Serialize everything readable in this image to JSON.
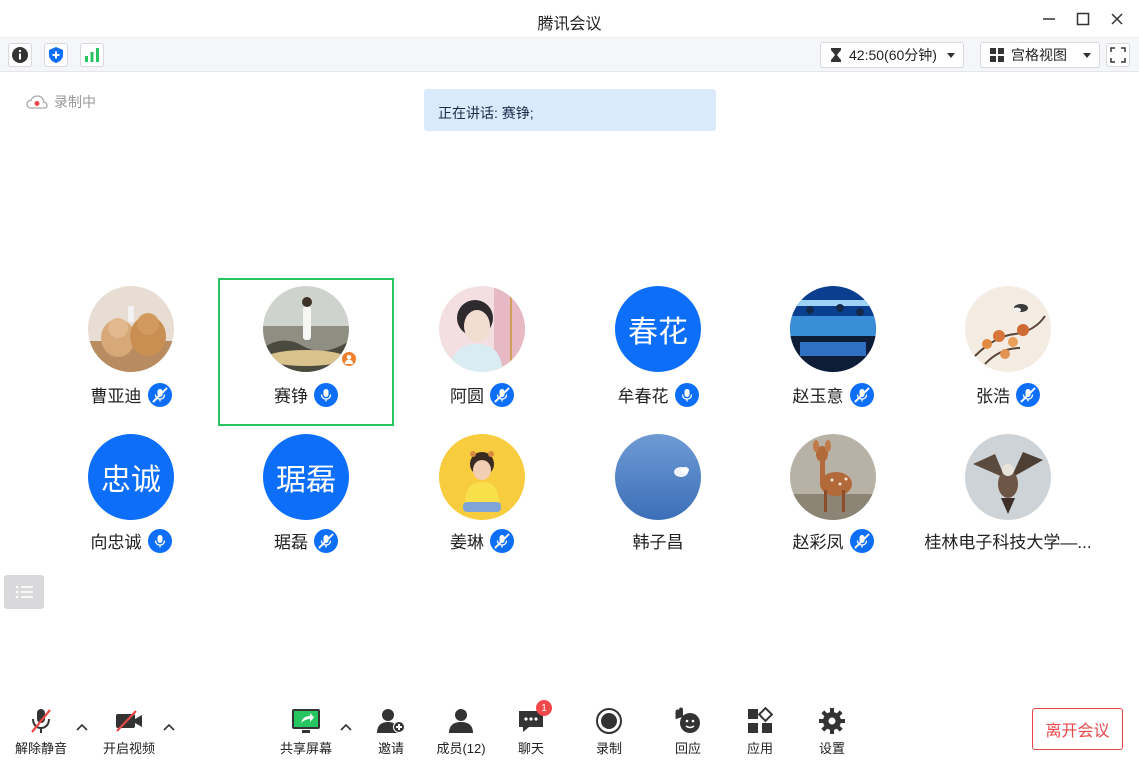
{
  "window": {
    "title": "腾讯会议"
  },
  "toolbar": {
    "timer": "42:50(60分钟)",
    "view_mode": "宫格视图"
  },
  "status": {
    "recording_label": "录制中",
    "speaking_label": "正在讲话: 赛铮;"
  },
  "participants": [
    {
      "name": "曹亚迪",
      "avatar_text": "",
      "mic": "muted"
    },
    {
      "name": "赛铮",
      "avatar_text": "",
      "mic": "on"
    },
    {
      "name": "阿圆",
      "avatar_text": "",
      "mic": "muted"
    },
    {
      "name": "牟春花",
      "avatar_text": "春花",
      "mic": "on"
    },
    {
      "name": "赵玉意",
      "avatar_text": "",
      "mic": "muted"
    },
    {
      "name": "张浩",
      "avatar_text": "",
      "mic": "muted"
    },
    {
      "name": "向忠诚",
      "avatar_text": "忠诚",
      "mic": "on"
    },
    {
      "name": "琚磊",
      "avatar_text": "琚磊",
      "mic": "muted"
    },
    {
      "name": "姜琳",
      "avatar_text": "",
      "mic": "muted"
    },
    {
      "name": "韩子昌",
      "avatar_text": "",
      "mic": "none"
    },
    {
      "name": "赵彩凤",
      "avatar_text": "",
      "mic": "muted"
    },
    {
      "name": "桂林电子科技大学—...",
      "avatar_text": "",
      "mic": "none"
    }
  ],
  "bottombar": {
    "unmute": "解除静音",
    "start_video": "开启视频",
    "share_screen": "共享屏幕",
    "invite": "邀请",
    "members": "成员(12)",
    "chat": "聊天",
    "chat_badge": "1",
    "record": "录制",
    "react": "回应",
    "apps": "应用",
    "settings": "设置",
    "leave": "离开会议"
  },
  "colors": {
    "accent": "#0c6ef9",
    "active_border": "#27c561",
    "leave": "#e84848"
  }
}
